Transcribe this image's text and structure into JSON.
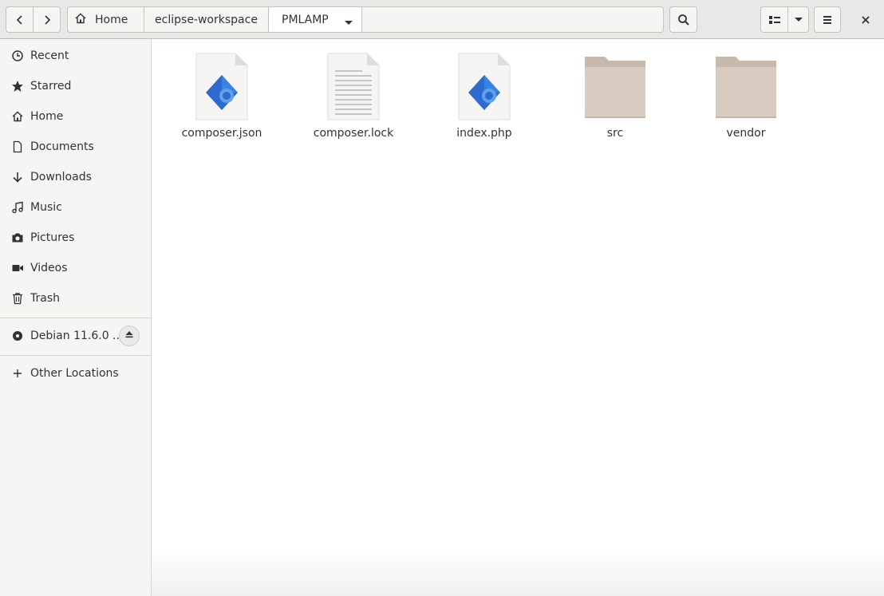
{
  "header": {
    "back_icon": "go-previous-icon",
    "forward_icon": "go-next-icon",
    "path": [
      {
        "label": "Home",
        "icon": "home-icon"
      },
      {
        "label": "eclipse-workspace"
      },
      {
        "label": "PMLAMP",
        "icon": "pan-down-icon"
      }
    ],
    "search_icon": "search-icon",
    "view_icon": "list-view-icon",
    "view_options_icon": "pan-down-icon",
    "menu_icon": "hamburger-menu-icon",
    "close_icon": "close-icon"
  },
  "sidebar": {
    "items": [
      {
        "label": "Recent",
        "icon": "clock-icon"
      },
      {
        "label": "Starred",
        "icon": "star-icon"
      },
      {
        "label": "Home",
        "icon": "home-icon"
      },
      {
        "label": "Documents",
        "icon": "document-icon"
      },
      {
        "label": "Downloads",
        "icon": "download-icon"
      },
      {
        "label": "Music",
        "icon": "music-icon"
      },
      {
        "label": "Pictures",
        "icon": "camera-icon"
      },
      {
        "label": "Videos",
        "icon": "video-icon"
      },
      {
        "label": "Trash",
        "icon": "trash-icon"
      }
    ],
    "device": {
      "label": "Debian 11.6.0 ...",
      "icon": "disc-icon",
      "eject_icon": "eject-icon"
    },
    "other": {
      "label": "Other Locations",
      "icon": "plus-icon"
    }
  },
  "files": [
    {
      "name": "composer.json",
      "icon": "script-file-icon"
    },
    {
      "name": "composer.lock",
      "icon": "text-file-icon"
    },
    {
      "name": "index.php",
      "icon": "script-file-icon"
    },
    {
      "name": "src",
      "icon": "folder-icon"
    },
    {
      "name": "vendor",
      "icon": "folder-icon"
    }
  ],
  "colors": {
    "folder": "#d8cbc0",
    "folder_tab": "#c9b9ab",
    "script_blue": "#2d6bd0",
    "accent": "#3584e4"
  }
}
